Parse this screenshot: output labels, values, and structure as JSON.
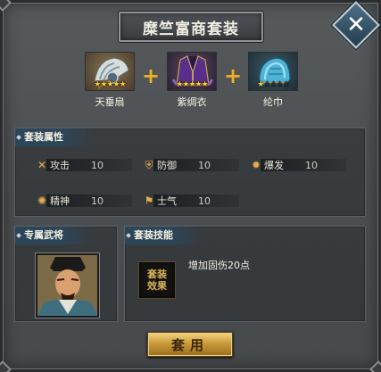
{
  "window": {
    "title": "糜竺富商套装",
    "close_label": "✕"
  },
  "items": [
    {
      "name": "天垂扇",
      "stars_filled": 5,
      "stars_total": 5,
      "icon": "fan-icon"
    },
    {
      "name": "紫绸衣",
      "stars_filled": 5,
      "stars_total": 5,
      "icon": "robe-icon"
    },
    {
      "name": "纶巾",
      "stars_filled": 1,
      "stars_total": 5,
      "icon": "headscarf-icon"
    }
  ],
  "plus_symbol": "+",
  "set_attributes": {
    "title": "套装属性",
    "rows": [
      {
        "label": "攻击",
        "value": "10",
        "icon": "swords-icon"
      },
      {
        "label": "防御",
        "value": "10",
        "icon": "shield-icon"
      },
      {
        "label": "爆发",
        "value": "10",
        "icon": "burst-icon"
      },
      {
        "label": "精神",
        "value": "10",
        "icon": "spirit-icon"
      },
      {
        "label": "士气",
        "value": "10",
        "icon": "banner-icon"
      }
    ]
  },
  "exclusive_general": {
    "title": "专属武将",
    "portrait": "general-portrait"
  },
  "set_skill": {
    "title": "套装技能",
    "icon_text_line1": "套装",
    "icon_text_line2": "效果",
    "description": "增加固伤20点"
  },
  "apply_button": {
    "label": "套用"
  },
  "colors": {
    "panel_header": "#2b4659",
    "star": "#ffcf2e",
    "plus": "#f0b020",
    "attr_icon": "#e7b04a",
    "button_gold": "#c99b3c"
  }
}
